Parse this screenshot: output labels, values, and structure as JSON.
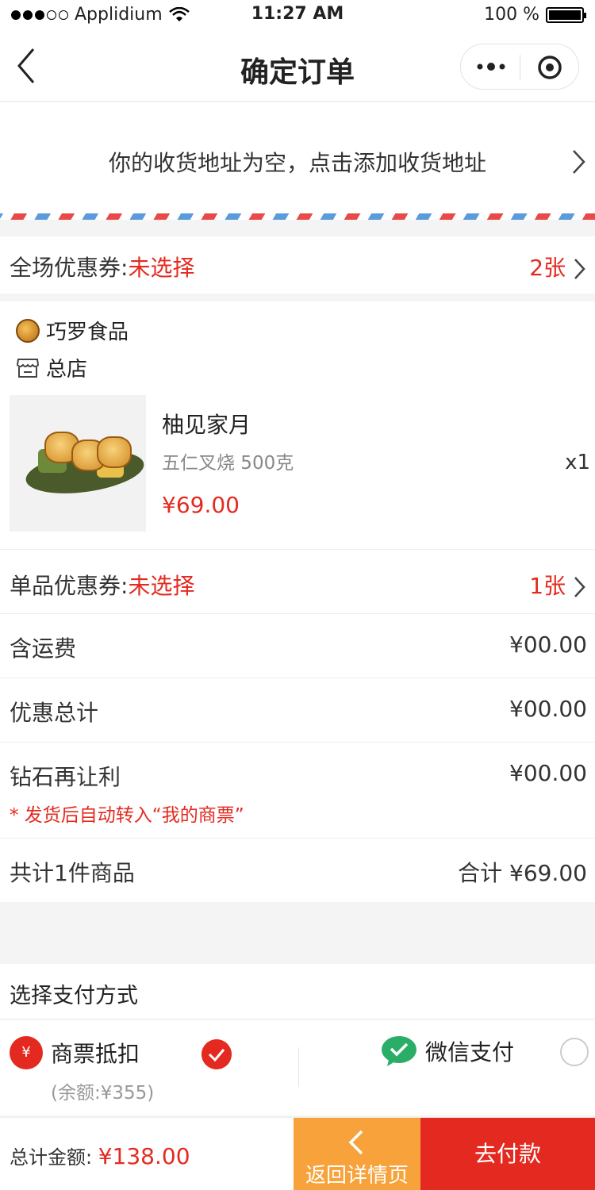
{
  "status_bar": {
    "carrier": "Applidium",
    "time": "11:27 AM",
    "battery": "100 %"
  },
  "nav": {
    "title": "确定订单"
  },
  "address": {
    "empty_text": "你的收货地址为空，点击添加收货地址"
  },
  "coupon_all": {
    "label": "全场优惠券:",
    "status": "未选择",
    "count": "2张"
  },
  "store": {
    "shop_name": "巧罗食品",
    "branch": "总店"
  },
  "product": {
    "name": "柚见家月",
    "spec": "五仁叉烧 500克",
    "price": "¥69.00",
    "qty": "x1"
  },
  "coupon_item": {
    "label": "单品优惠券:",
    "status": "未选择",
    "count": "1张"
  },
  "fees": [
    {
      "label": "含运费",
      "value": "¥00.00"
    },
    {
      "label": "优惠总计",
      "value": "¥00.00"
    },
    {
      "label": "钻石再让利",
      "value": "¥00.00"
    }
  ],
  "note": "* 发货后自动转入“我的商票”",
  "summary": {
    "count_text": "共计1件商品",
    "total_text": "合计 ¥69.00"
  },
  "payment": {
    "heading": "选择支付方式",
    "option_a": {
      "label": "商票抵扣",
      "balance": "(余额:¥355)",
      "selected": true
    },
    "option_b": {
      "label": "微信支付",
      "selected": false
    }
  },
  "footer": {
    "total_label": "总计金额:",
    "total_amount": "¥138.00",
    "back_label": "返回详情页",
    "pay_label": "去付款"
  },
  "colors": {
    "accent_red": "#e42a20",
    "orange": "#f7a23a",
    "wechat_green": "#2aae67"
  }
}
